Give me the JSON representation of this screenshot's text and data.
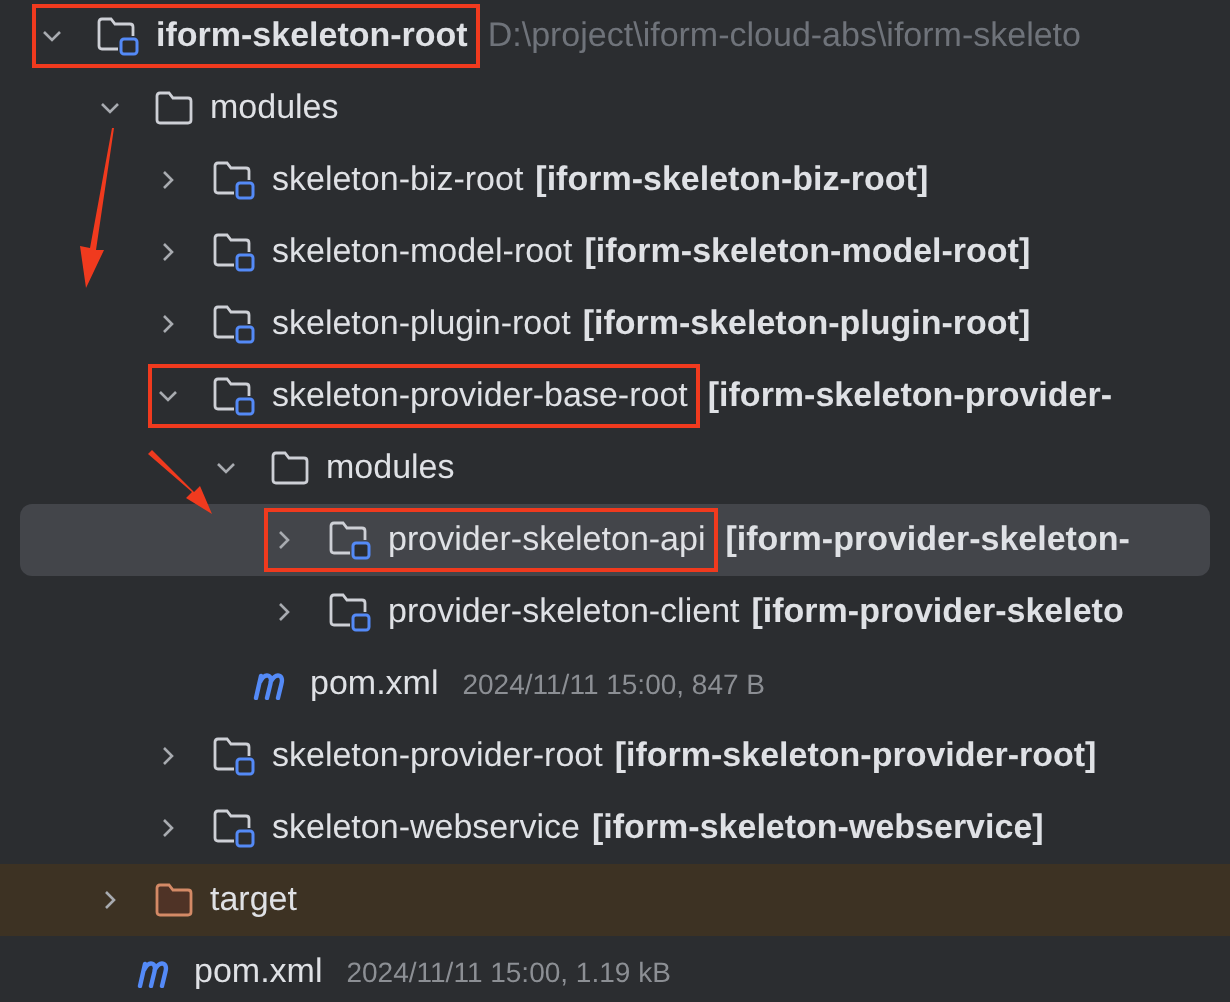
{
  "tree": [
    {
      "kind": "module",
      "name": "iform-skeleton-root",
      "bold_name": true,
      "path": "D:\\project\\iform-cloud-abs\\iform-skeleto",
      "expanded": true,
      "highlighted": true,
      "selected": false,
      "children": [
        {
          "kind": "folder",
          "name": "modules",
          "expanded": true,
          "highlighted": false,
          "selected": false,
          "children": [
            {
              "kind": "module",
              "name": "skeleton-biz-root",
              "module_tag": "[iform-skeleton-biz-root]",
              "expanded": false,
              "highlighted": false,
              "selected": false
            },
            {
              "kind": "module",
              "name": "skeleton-model-root",
              "module_tag": "[iform-skeleton-model-root]",
              "expanded": false,
              "highlighted": false,
              "selected": false
            },
            {
              "kind": "module",
              "name": "skeleton-plugin-root",
              "module_tag": "[iform-skeleton-plugin-root]",
              "expanded": false,
              "highlighted": false,
              "selected": false
            },
            {
              "kind": "module",
              "name": "skeleton-provider-base-root",
              "module_tag": "[iform-skeleton-provider-",
              "expanded": true,
              "highlighted": true,
              "selected": false,
              "children": [
                {
                  "kind": "folder",
                  "name": "modules",
                  "expanded": true,
                  "highlighted": false,
                  "selected": false,
                  "children": [
                    {
                      "kind": "module",
                      "name": "provider-skeleton-api",
                      "module_tag": "[iform-provider-skeleton-",
                      "expanded": false,
                      "highlighted": true,
                      "selected": true
                    },
                    {
                      "kind": "module",
                      "name": "provider-skeleton-client",
                      "module_tag": "[iform-provider-skeleto",
                      "expanded": false,
                      "highlighted": false,
                      "selected": false
                    }
                  ]
                },
                {
                  "kind": "maven",
                  "name": "pom.xml",
                  "meta": "2024/11/11 15:00, 847 B",
                  "highlighted": false,
                  "selected": false
                }
              ]
            },
            {
              "kind": "module",
              "name": "skeleton-provider-root",
              "module_tag": "[iform-skeleton-provider-root]",
              "expanded": false,
              "highlighted": false,
              "selected": false
            },
            {
              "kind": "module",
              "name": "skeleton-webservice",
              "module_tag": "[iform-skeleton-webservice]",
              "expanded": false,
              "highlighted": false,
              "selected": false
            }
          ]
        },
        {
          "kind": "excluded",
          "name": "target",
          "expanded": false,
          "highlighted": false,
          "selected": false
        },
        {
          "kind": "maven",
          "name": "pom.xml",
          "meta": "2024/11/11 15:00, 1.19 kB",
          "highlighted": false,
          "selected": false
        }
      ]
    }
  ]
}
